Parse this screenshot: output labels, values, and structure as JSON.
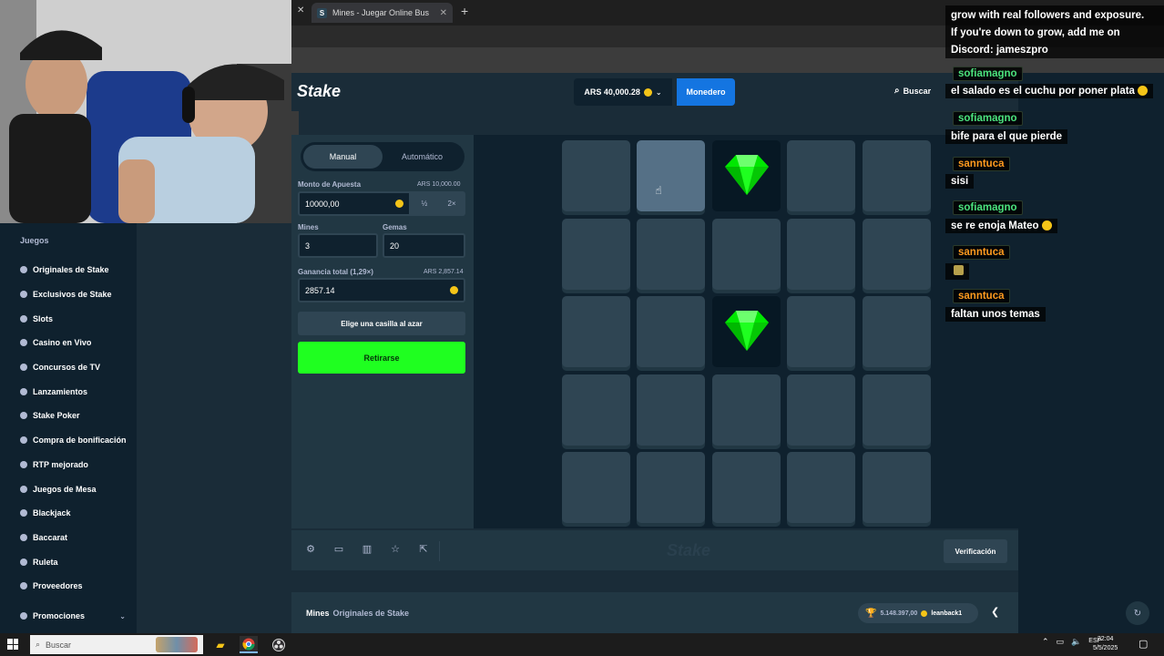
{
  "browser": {
    "tab_title": "Mines - Juegar Online Bus",
    "tab_favicon": "S",
    "new_tab": "+",
    "close_tab": "✕"
  },
  "header": {
    "logo": "Stake",
    "balance": "ARS 40,000.28",
    "wallet_label": "Monedero",
    "search_label": "Buscar"
  },
  "leftnav": {
    "heading": "Juegos",
    "items": [
      "Originales de Stake",
      "Exclusivos de Stake",
      "Slots",
      "Casino en Vivo",
      "Concursos de TV",
      "Lanzamientos",
      "Stake Poker",
      "Compra de bonificación",
      "RTP mejorado",
      "Juegos de Mesa",
      "Blackjack",
      "Baccarat",
      "Ruleta",
      "Proveedores"
    ],
    "promo": "Promociones"
  },
  "betpanel": {
    "tab_manual": "Manual",
    "tab_auto": "Automático",
    "bet_label": "Monto de Apuesta",
    "bet_limit": "ARS 10,000.00",
    "bet_value": "10000,00",
    "half": "½",
    "double": "2×",
    "mines_label": "Mines",
    "mines_value": "3",
    "gems_label": "Gemas",
    "gems_value": "20",
    "profit_label": "Ganancia total (1,29×)",
    "profit_limit": "ARS 2,857.14",
    "profit_value": "2857.14",
    "random_button": "Elige una casilla al azar",
    "cashout_button": "Retirarse"
  },
  "board": {
    "grid_size": 5,
    "gems_revealed": [
      2,
      12
    ],
    "hovered_tile": 1
  },
  "footer": {
    "watermark": "Stake",
    "verify_button": "Verificación",
    "icons": [
      "gear-icon",
      "theater-icon",
      "stats-icon",
      "star-icon",
      "popout-icon"
    ]
  },
  "bottom": {
    "game_name": "Mines",
    "game_category": "Originales de Stake",
    "win_amount": "5.148.397,00",
    "win_user": "leanback1"
  },
  "chat": {
    "top_text1": "grow with real followers and exposure.",
    "top_text2": "If you're down to grow, add me on",
    "top_text3": "Discord: jameszpro",
    "messages": [
      {
        "user": "sofiamagno",
        "text": "el salado es el cuchu por poner plata",
        "color": "green"
      },
      {
        "user": "sofiamagno",
        "text": "bife para el que pierde",
        "color": "green"
      },
      {
        "user": "sanntuca",
        "text": "sisi",
        "color": "orange"
      },
      {
        "user": "sofiamagno",
        "text": "se re enoja Mateo",
        "color": "green"
      },
      {
        "user": "sanntuca",
        "text": "",
        "color": "orange"
      },
      {
        "user": "sanntuca",
        "text": "faltan unos temas",
        "color": "orange"
      }
    ]
  },
  "taskbar": {
    "search_placeholder": "Buscar",
    "lang": "ESP",
    "time": "22:04",
    "date": "5/5/2025"
  },
  "colors": {
    "accent_green": "#1fff20",
    "wallet_blue": "#1475e1",
    "gem_green": "#00e701"
  }
}
